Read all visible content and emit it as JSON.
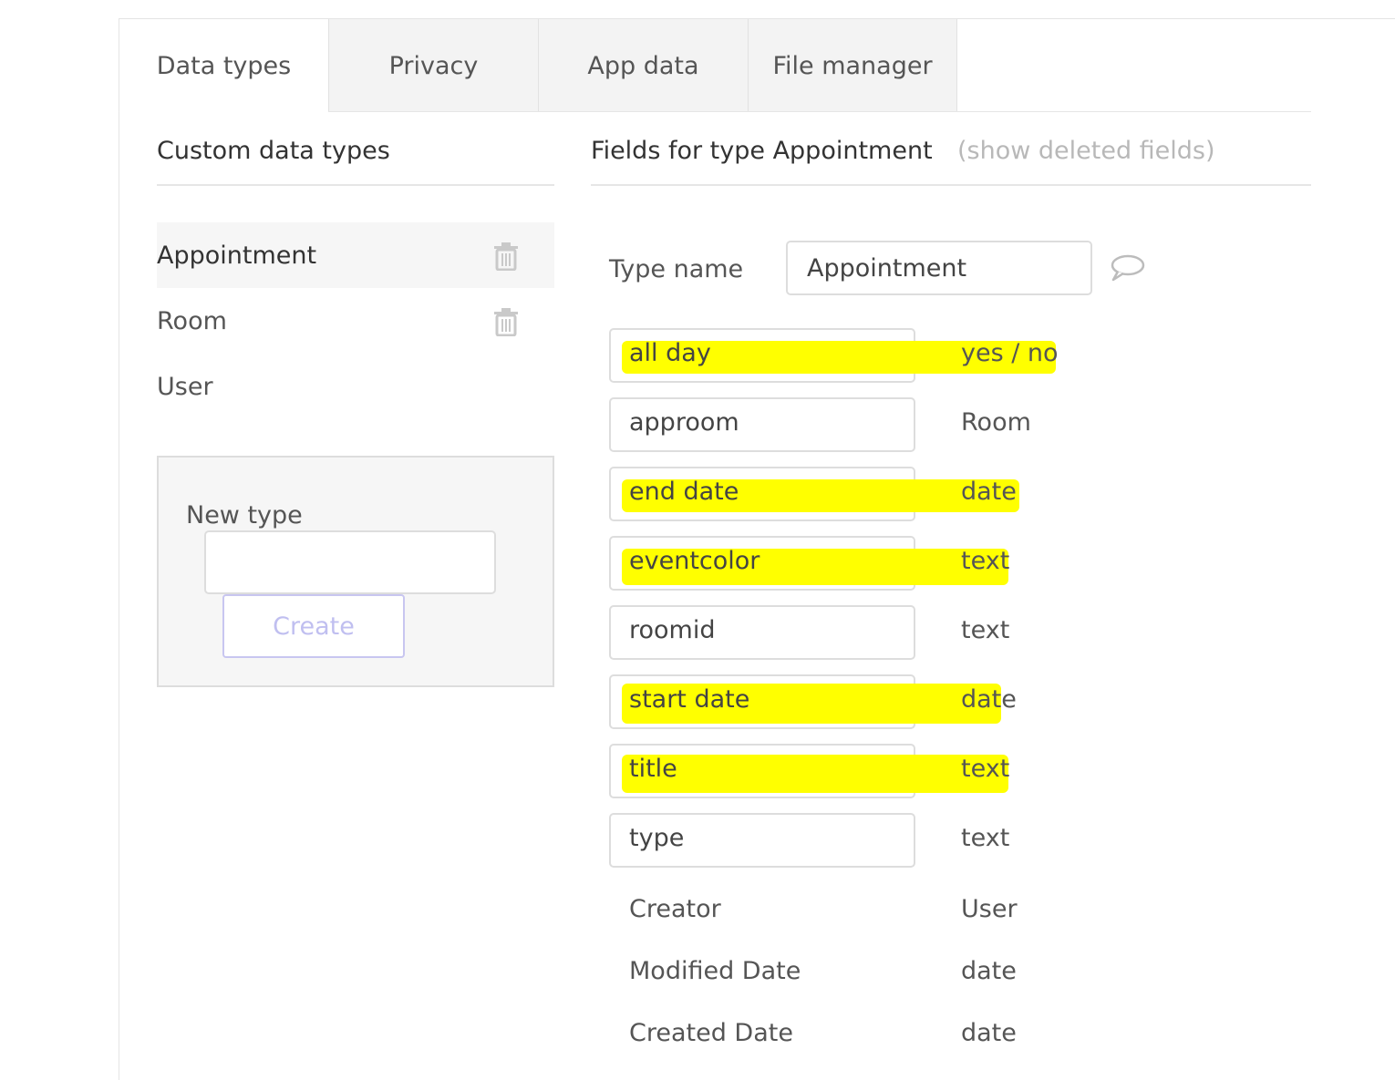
{
  "tabs": [
    {
      "label": "Data types",
      "active": true
    },
    {
      "label": "Privacy",
      "active": false
    },
    {
      "label": "App data",
      "active": false
    },
    {
      "label": "File manager",
      "active": false
    }
  ],
  "left_panel": {
    "title": "Custom data types",
    "types": [
      {
        "name": "Appointment",
        "selected": true,
        "deletable": true
      },
      {
        "name": "Room",
        "selected": false,
        "deletable": true
      },
      {
        "name": "User",
        "selected": false,
        "deletable": false
      }
    ],
    "new_type": {
      "label": "New type",
      "input_value": "",
      "create_label": "Create"
    }
  },
  "right_panel": {
    "title": "Fields for type Appointment",
    "show_deleted_link": "(show deleted fields)",
    "type_name_label": "Type name",
    "type_name_value": "Appointment",
    "fields": [
      {
        "name": "all day",
        "type": "yes / no",
        "highlighted": true
      },
      {
        "name": "approom",
        "type": "Room",
        "highlighted": false
      },
      {
        "name": "end date",
        "type": "date",
        "highlighted": true
      },
      {
        "name": "eventcolor",
        "type": "text",
        "highlighted": true
      },
      {
        "name": "roomid",
        "type": "text",
        "highlighted": false
      },
      {
        "name": "start date",
        "type": "date",
        "highlighted": true
      },
      {
        "name": "title",
        "type": "text",
        "highlighted": true
      },
      {
        "name": "type",
        "type": "text",
        "highlighted": false
      }
    ],
    "builtin_fields": [
      {
        "name": "Creator",
        "type": "User"
      },
      {
        "name": "Modified Date",
        "type": "date"
      },
      {
        "name": "Created Date",
        "type": "date"
      }
    ]
  },
  "colors": {
    "highlight": "#ffff00",
    "create_button_border": "#c8c6f0",
    "muted_text": "#b8b8b8"
  },
  "icons": {
    "delete": "trash-icon",
    "comment": "comment-icon"
  }
}
